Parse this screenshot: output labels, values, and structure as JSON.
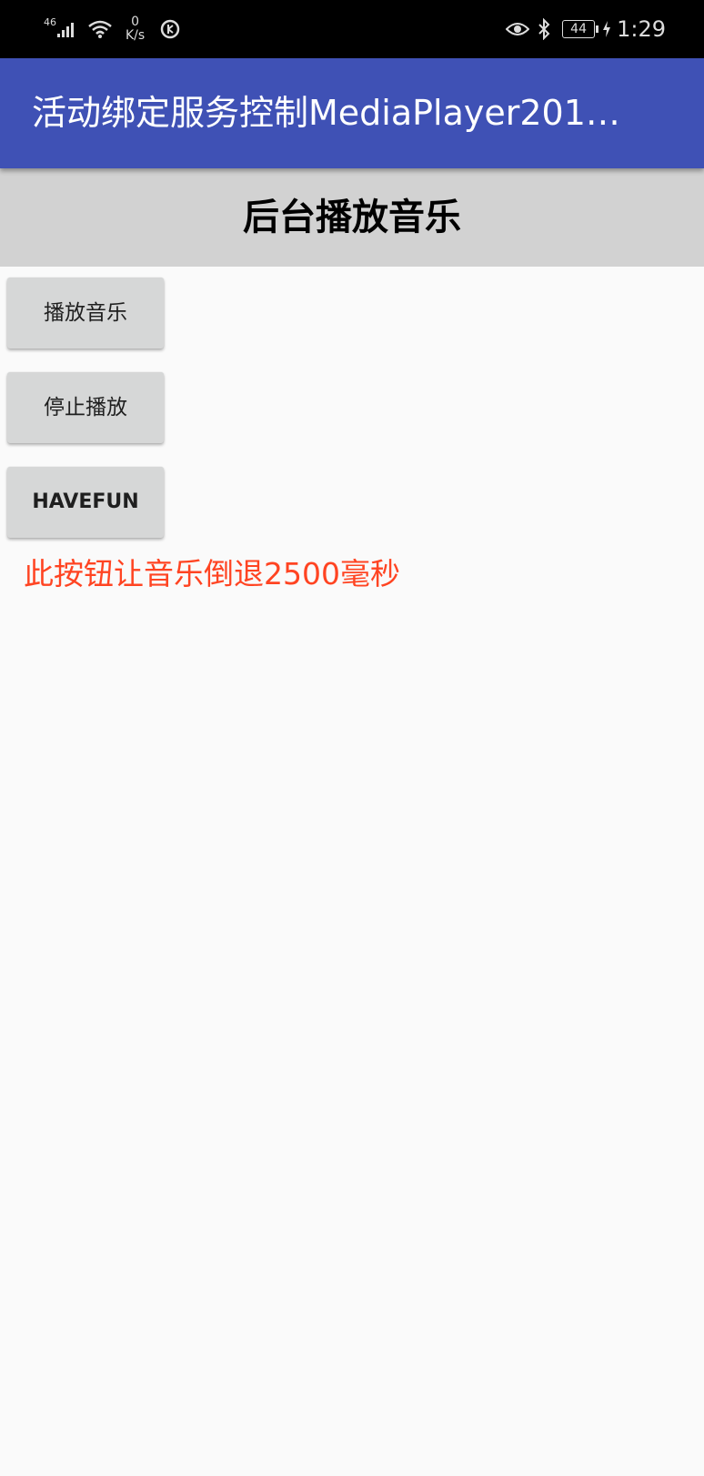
{
  "status_bar": {
    "network_type": "46",
    "speed_value": "0",
    "speed_unit": "K/s",
    "battery": "44",
    "time": "1:29"
  },
  "app_bar": {
    "title": "活动绑定服务控制MediaPlayer201…"
  },
  "header": {
    "title": "后台播放音乐"
  },
  "buttons": {
    "play": "播放音乐",
    "stop": "停止播放",
    "havefun": "HAVEFUN"
  },
  "hint": "此按钮让音乐倒退2500毫秒",
  "colors": {
    "app_bar": "#3f51b5",
    "header_band": "#d2d2d2",
    "hint_text": "#ff4422",
    "button_bg": "#d6d7d7",
    "background": "#fafafa"
  }
}
